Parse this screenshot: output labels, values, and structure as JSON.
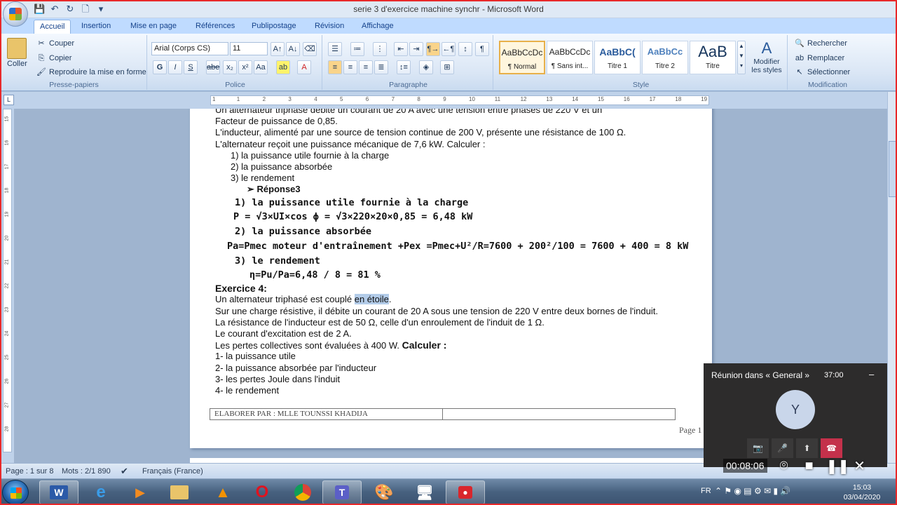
{
  "window": {
    "title": "serie 3 d'exercice  machine synchr - Microsoft Word"
  },
  "tabs": [
    "Accueil",
    "Insertion",
    "Mise en page",
    "Références",
    "Publipostage",
    "Révision",
    "Affichage"
  ],
  "ribbon": {
    "clipboard": {
      "label": "Presse-papiers",
      "paste": "Coller",
      "cut": "Couper",
      "copy": "Copier",
      "format_painter": "Reproduire la mise en forme"
    },
    "font": {
      "label": "Police",
      "font_name": "Arial (Corps CS)",
      "font_size": "11"
    },
    "paragraph": {
      "label": "Paragraphe"
    },
    "styles": {
      "label": "Style",
      "items": [
        {
          "preview": "AaBbCcDc",
          "name": "¶ Normal"
        },
        {
          "preview": "AaBbCcDc",
          "name": "¶ Sans int..."
        },
        {
          "preview": "AaBbC(",
          "name": "Titre 1"
        },
        {
          "preview": "AaBbCc",
          "name": "Titre 2"
        },
        {
          "preview": "AaB",
          "name": "Titre"
        }
      ],
      "change": "Modifier les styles"
    },
    "editing": {
      "label": "Modification",
      "find": "Rechercher",
      "replace": "Remplacer",
      "select": "Sélectionner"
    }
  },
  "document": {
    "lines": [
      {
        "text": "Un alternateur triphasé débite un courant de 20 A avec une tension entre phases de 220 V et un",
        "cls": ""
      },
      {
        "text": "Facteur de puissance de 0,85.",
        "cls": ""
      },
      {
        "text": "L'inducteur, alimenté par une source de tension continue de 200 V, présente une résistance de 100 Ω.",
        "cls": ""
      },
      {
        "text": "L'alternateur reçoit une puissance mécanique de 7,6 kW. Calculer :",
        "cls": ""
      },
      {
        "text": "1)   la puissance utile fournie à la charge",
        "cls": "in1"
      },
      {
        "text": "2)    la puissance absorbée",
        "cls": "in1"
      },
      {
        "text": "3)   le rendement",
        "cls": "in1"
      },
      {
        "text": "➢   Réponse3",
        "cls": "in2 bold"
      }
    ],
    "answer_lines": [
      {
        "text": "1)  la puissance utile fournie à la charge",
        "pad": 28
      },
      {
        "text": "P = √3×UI×cos ϕ = √3×220×20×0,85 = 6,48 kW",
        "pad": 26
      },
      {
        "text": "2)  la puissance absorbée",
        "pad": 28
      },
      {
        "text": "Pa=Pmec moteur d'entraînement +Pex =Pmec+U²/R=7600 + 200²/100 = 7600 + 400 = 8 kW",
        "pad": 17
      },
      {
        "text": "3)  le rendement",
        "pad": 28
      },
      {
        "text": "η=Pu/Pa=6,48 / 8 = 81 %",
        "pad": 49
      }
    ],
    "exercise_title": "Exercice 4:",
    "ex4_intro_before": "Un alternateur triphasé est couplé ",
    "ex4_intro_selected": "en étoile",
    "ex4_intro_after": ".",
    "ex4_lines": [
      "Sur une charge résistive, il débite un courant de 20 A sous une tension de 220 V entre deux bornes de l'induit.",
      "La résistance de l'inducteur est de 50 Ω, celle d'un enroulement de l'induit de 1 Ω.",
      "Le courant d'excitation est de 2 A."
    ],
    "losses_text": "Les pertes collectives sont évaluées à 400 W. ",
    "calc_label": "Calculer :",
    "questions": [
      "1- la puissance utile",
      "2- la puissance absorbée par l'inducteur",
      "3- les pertes Joule dans l'induit",
      "4- le rendement"
    ],
    "footer": "ELABORER PAR : MLLE TOUNSSI KHADIJA",
    "page_label": "Page 1"
  },
  "status": {
    "page": "Page : 1 sur 8",
    "words": "Mots : 2/1 890",
    "language": "Français (France)"
  },
  "teams": {
    "title": "Réunion dans « General »",
    "time": "37:00",
    "avatar": "Y",
    "minimize": "–"
  },
  "recorder": {
    "elapsed": "00:08:06"
  },
  "tray": {
    "lang": "FR",
    "time": "15:03",
    "date": "03/04/2020"
  },
  "ruler_numbers": [
    "1",
    "1",
    "2",
    "3",
    "4",
    "5",
    "6",
    "7",
    "8",
    "9",
    "10",
    "11",
    "12",
    "13",
    "14",
    "15",
    "16",
    "17",
    "18",
    "19"
  ],
  "vruler_numbers": [
    "15",
    "16",
    "17",
    "18",
    "19",
    "20",
    "21",
    "22",
    "23",
    "24",
    "25",
    "26",
    "27",
    "28"
  ],
  "colors": {
    "accent": "#15428b",
    "selection": "#b3cce9",
    "hangup": "#c4314b"
  }
}
